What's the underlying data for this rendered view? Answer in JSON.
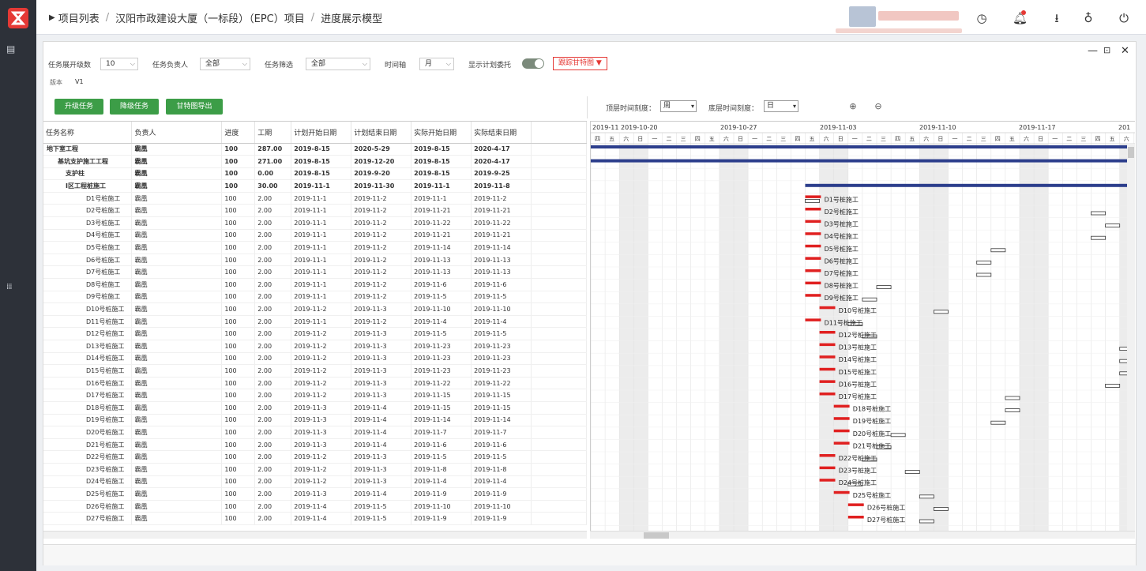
{
  "breadcrumb": {
    "item1": "项目列表",
    "sep": "/",
    "item2": "汉阳市政建设大厦（一标段）（EPC）项目",
    "item3": "进度展示模型"
  },
  "filters": {
    "level_label": "任务展开级数",
    "level_value": "10",
    "owner_label": "任务负责人",
    "owner_value": "全部",
    "filter_label": "任务筛选",
    "filter_value": "全部",
    "axis_label": "时间轴",
    "axis_value": "月",
    "plan_label": "显示计划委托",
    "tracker_label": "跟踪甘特图"
  },
  "version": {
    "label": "版本",
    "value": "V1"
  },
  "buttons": {
    "upgrade": "升级任务",
    "downgrade": "降级任务",
    "export": "甘特图导出"
  },
  "zoom": {
    "top_label": "顶层时间刻度：",
    "top_value": "周",
    "bottom_label": "底层时间刻度：",
    "bottom_value": "日"
  },
  "table": {
    "headers": [
      "任务名称",
      "负责人",
      "进度",
      "工期",
      "计划开始日期",
      "计划结束日期",
      "实际开始日期",
      "实际结束日期"
    ],
    "rows": [
      [
        "地下室工程",
        "霸凰",
        "100",
        "287.00",
        "2019-8-15",
        "2020-5-29",
        "2019-8-15",
        "2020-4-17"
      ],
      [
        "基坑支护施工工程",
        "霸凰",
        "100",
        "271.00",
        "2019-8-15",
        "2019-12-20",
        "2019-8-15",
        "2020-4-17"
      ],
      [
        "支护柱",
        "霸凰",
        "100",
        "0.00",
        "2019-8-15",
        "2019-9-20",
        "2019-8-15",
        "2019-9-25"
      ],
      [
        "I区工程桩施工",
        "霸凰",
        "100",
        "30.00",
        "2019-11-1",
        "2019-11-30",
        "2019-11-1",
        "2019-11-8"
      ],
      [
        "D1号桩施工",
        "霸凰",
        "100",
        "2.00",
        "2019-11-1",
        "2019-11-2",
        "2019-11-1",
        "2019-11-2"
      ],
      [
        "D2号桩施工",
        "霸凰",
        "100",
        "2.00",
        "2019-11-1",
        "2019-11-2",
        "2019-11-21",
        "2019-11-21"
      ],
      [
        "D3号桩施工",
        "霸凰",
        "100",
        "2.00",
        "2019-11-1",
        "2019-11-2",
        "2019-11-22",
        "2019-11-22"
      ],
      [
        "D4号桩施工",
        "霸凰",
        "100",
        "2.00",
        "2019-11-1",
        "2019-11-2",
        "2019-11-21",
        "2019-11-21"
      ],
      [
        "D5号桩施工",
        "霸凰",
        "100",
        "2.00",
        "2019-11-1",
        "2019-11-2",
        "2019-11-14",
        "2019-11-14"
      ],
      [
        "D6号桩施工",
        "霸凰",
        "100",
        "2.00",
        "2019-11-1",
        "2019-11-2",
        "2019-11-13",
        "2019-11-13"
      ],
      [
        "D7号桩施工",
        "霸凰",
        "100",
        "2.00",
        "2019-11-1",
        "2019-11-2",
        "2019-11-13",
        "2019-11-13"
      ],
      [
        "D8号桩施工",
        "霸凰",
        "100",
        "2.00",
        "2019-11-1",
        "2019-11-2",
        "2019-11-6",
        "2019-11-6"
      ],
      [
        "D9号桩施工",
        "霸凰",
        "100",
        "2.00",
        "2019-11-1",
        "2019-11-2",
        "2019-11-5",
        "2019-11-5"
      ],
      [
        "D10号桩施工",
        "霸凰",
        "100",
        "2.00",
        "2019-11-2",
        "2019-11-3",
        "2019-11-10",
        "2019-11-10"
      ],
      [
        "D11号桩施工",
        "霸凰",
        "100",
        "2.00",
        "2019-11-1",
        "2019-11-2",
        "2019-11-4",
        "2019-11-4"
      ],
      [
        "D12号桩施工",
        "霸凰",
        "100",
        "2.00",
        "2019-11-2",
        "2019-11-3",
        "2019-11-5",
        "2019-11-5"
      ],
      [
        "D13号桩施工",
        "霸凰",
        "100",
        "2.00",
        "2019-11-2",
        "2019-11-3",
        "2019-11-23",
        "2019-11-23"
      ],
      [
        "D14号桩施工",
        "霸凰",
        "100",
        "2.00",
        "2019-11-2",
        "2019-11-3",
        "2019-11-23",
        "2019-11-23"
      ],
      [
        "D15号桩施工",
        "霸凰",
        "100",
        "2.00",
        "2019-11-2",
        "2019-11-3",
        "2019-11-23",
        "2019-11-23"
      ],
      [
        "D16号桩施工",
        "霸凰",
        "100",
        "2.00",
        "2019-11-2",
        "2019-11-3",
        "2019-11-22",
        "2019-11-22"
      ],
      [
        "D17号桩施工",
        "霸凰",
        "100",
        "2.00",
        "2019-11-2",
        "2019-11-3",
        "2019-11-15",
        "2019-11-15"
      ],
      [
        "D18号桩施工",
        "霸凰",
        "100",
        "2.00",
        "2019-11-3",
        "2019-11-4",
        "2019-11-15",
        "2019-11-15"
      ],
      [
        "D19号桩施工",
        "霸凰",
        "100",
        "2.00",
        "2019-11-3",
        "2019-11-4",
        "2019-11-14",
        "2019-11-14"
      ],
      [
        "D20号桩施工",
        "霸凰",
        "100",
        "2.00",
        "2019-11-3",
        "2019-11-4",
        "2019-11-7",
        "2019-11-7"
      ],
      [
        "D21号桩施工",
        "霸凰",
        "100",
        "2.00",
        "2019-11-3",
        "2019-11-4",
        "2019-11-6",
        "2019-11-6"
      ],
      [
        "D22号桩施工",
        "霸凰",
        "100",
        "2.00",
        "2019-11-2",
        "2019-11-3",
        "2019-11-5",
        "2019-11-5"
      ],
      [
        "D23号桩施工",
        "霸凰",
        "100",
        "2.00",
        "2019-11-2",
        "2019-11-3",
        "2019-11-8",
        "2019-11-8"
      ],
      [
        "D24号桩施工",
        "霸凰",
        "100",
        "2.00",
        "2019-11-2",
        "2019-11-3",
        "2019-11-4",
        "2019-11-4"
      ],
      [
        "D25号桩施工",
        "霸凰",
        "100",
        "2.00",
        "2019-11-3",
        "2019-11-4",
        "2019-11-9",
        "2019-11-9"
      ],
      [
        "D26号桩施工",
        "霸凰",
        "100",
        "2.00",
        "2019-11-4",
        "2019-11-5",
        "2019-11-10",
        "2019-11-10"
      ],
      [
        "D27号桩施工",
        "霸凰",
        "100",
        "2.00",
        "2019-11-4",
        "2019-11-5",
        "2019-11-9",
        "2019-11-9"
      ]
    ]
  },
  "gantt": {
    "weeks": [
      "2019-11",
      "2019-10-20",
      "2019-10-27",
      "2019-11-03",
      "2019-11-10",
      "2019-11-17",
      "201"
    ],
    "weekdays": [
      "四",
      "五",
      "六",
      "日",
      "一",
      "二",
      "三"
    ],
    "day_labels": [
      "五",
      "六",
      "日",
      "一",
      "二",
      "三",
      "四",
      "五",
      "六",
      "日",
      "一",
      "二",
      "三",
      "四",
      "五",
      "六",
      "日",
      "一",
      "二",
      "三",
      "四",
      "五",
      "六",
      "日",
      "一",
      "二",
      "三",
      "四",
      "五",
      "六",
      "日",
      "一",
      "二",
      "三",
      "四",
      "五",
      "六"
    ],
    "task_labels": [
      "D1号桩施工",
      "D2号桩施工",
      "D3号桩施工",
      "D4号桩施工",
      "D5号桩施工",
      "D6号桩施工",
      "D7号桩施工",
      "D8号桩施工",
      "D9号桩施工",
      "D10号桩施工",
      "D11号桩施工",
      "D12号桩施工",
      "D13号桩施工",
      "D14号桩施工",
      "D15号桩施工",
      "D16号桩施工",
      "D17号桩施工",
      "D18号桩施工",
      "D19号桩施工",
      "D20号桩施工",
      "D21号桩施工",
      "D22号桩施工",
      "D23号桩施工",
      "D24号桩施工",
      "D25号桩施工",
      "D26号桩施工",
      "D27号桩施工"
    ],
    "colors": {
      "plan": "#e02020",
      "actual": "#ffffff",
      "summary": "#2c3e8c",
      "weekend": "#ececec"
    }
  }
}
